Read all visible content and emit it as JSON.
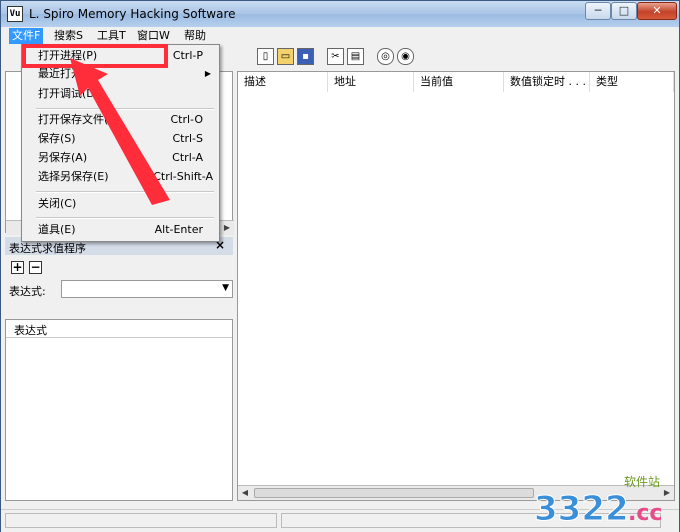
{
  "window": {
    "title": "L. Spiro   Memory Hacking Software",
    "app_icon_text": "Vu"
  },
  "window_controls": {
    "minimize": "─",
    "maximize": "□",
    "close": "✕"
  },
  "menubar": [
    "文件F",
    "搜索S",
    "工具T",
    "窗口W",
    "帮助"
  ],
  "file_menu": {
    "items": [
      {
        "label": "打开进程(P)",
        "shortcut": "Ctrl-P"
      },
      {
        "label": "最近打开",
        "shortcut": "",
        "submenu": true
      },
      {
        "label": "打开调试(D)",
        "shortcut": ""
      },
      {
        "label": "打开保存文件(O)",
        "shortcut": "Ctrl-O"
      },
      {
        "label": "保存(S)",
        "shortcut": "Ctrl-S"
      },
      {
        "label": "另保存(A)",
        "shortcut": "Ctrl-A"
      },
      {
        "label": "选择另保存(E)",
        "shortcut": "Ctrl-Shift-A"
      },
      {
        "label": "关闭(C)",
        "shortcut": ""
      },
      {
        "label": "道具(E)",
        "shortcut": "Alt-Enter"
      }
    ]
  },
  "left_panel": {
    "section_title": "表达式求值程序",
    "section_close": "×",
    "add_button": "+",
    "remove_button": "−",
    "expression_label": "表达式:",
    "expression_value": "",
    "list_header": "表达式"
  },
  "results_table": {
    "columns": [
      "描述",
      "地址",
      "当前值",
      "数值锁定时 . . .",
      "类型"
    ]
  },
  "watermark": {
    "number": "3322",
    "domain": ".cc",
    "tag": "软件站"
  },
  "colors": {
    "highlight_red": "#ff2d3a",
    "menu_active": "#3399ff",
    "titlebar": "#a9c4e6"
  }
}
